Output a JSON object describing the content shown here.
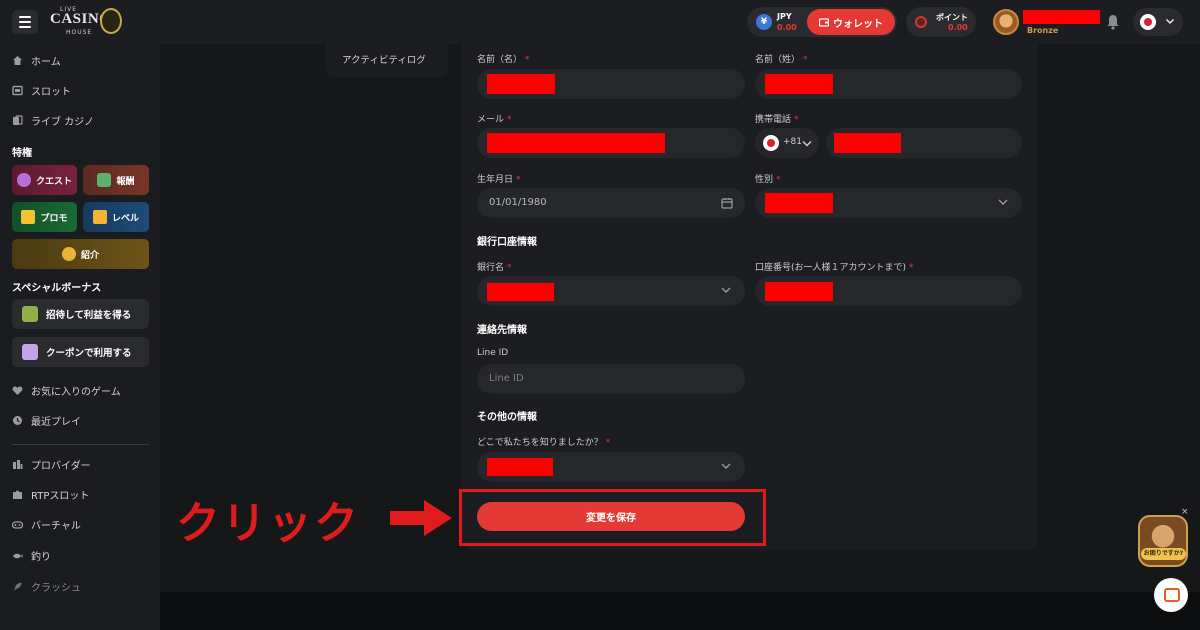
{
  "header": {
    "logo": {
      "top": "LIVE",
      "main": "CASINO",
      "bottom": "HOUSE"
    },
    "currency_code": "JPY",
    "currency_amount": "0.00",
    "wallet_label": "ウォレット",
    "points_label": "ポイント",
    "points_amount": "0.00",
    "rank": "Bronze"
  },
  "sidebar": {
    "nav_top": [
      {
        "label": "ホーム",
        "icon": "home-icon"
      },
      {
        "label": "スロット",
        "icon": "slot-icon"
      },
      {
        "label": "ライブ カジノ",
        "icon": "cards-icon"
      }
    ],
    "perks_title": "特権",
    "perks": [
      {
        "label": "クエスト",
        "icon": "quest-icon"
      },
      {
        "label": "報酬",
        "icon": "reward-icon"
      },
      {
        "label": "プロモ",
        "icon": "promo-icon"
      },
      {
        "label": "レベル",
        "icon": "crown-icon"
      },
      {
        "label": "紹介",
        "icon": "referral-icon"
      }
    ],
    "special_title": "スペシャルボーナス",
    "bonus_buttons": [
      {
        "label": "招待して利益を得る",
        "icon": "invite-icon"
      },
      {
        "label": "クーポンで利用する",
        "icon": "coupon-icon"
      }
    ],
    "nav_mid": [
      {
        "label": "お気に入りのゲーム",
        "icon": "heart-icon"
      },
      {
        "label": "最近プレイ",
        "icon": "clock-icon"
      }
    ],
    "nav_bottom": [
      {
        "label": "プロバイダー",
        "icon": "provider-icon"
      },
      {
        "label": "RTPスロット",
        "icon": "puzzle-icon"
      },
      {
        "label": "バーチャル",
        "icon": "gamepad-icon"
      },
      {
        "label": "釣り",
        "icon": "fishing-icon"
      },
      {
        "label": "クラッシュ",
        "icon": "rocket-icon"
      }
    ]
  },
  "tab_menu": {
    "item": "アクティビティログ"
  },
  "form": {
    "first_name_label": "名前（名）",
    "last_name_label": "名前（姓）",
    "email_label": "メール",
    "phone_label": "携帯電話",
    "country_code": "+81",
    "birthdate_label": "生年月日",
    "birthdate_value": "01/01/1980",
    "gender_label": "性別",
    "bank_section": "銀行口座情報",
    "bank_name_label": "銀行名",
    "account_number_label": "口座番号(お一人様１アカウントまで)",
    "contact_section": "連絡先情報",
    "line_id_label": "Line ID",
    "line_id_placeholder": "Line ID",
    "other_section": "その他の情報",
    "referral_source_label": "どこで私たちを知りましたか？",
    "required_mark": "*",
    "save_label": "変更を保存"
  },
  "annotation": {
    "click_text": "クリック"
  },
  "support": {
    "tag": "お困りですか?",
    "close": "×"
  },
  "colors": {
    "accent": "#e53935",
    "redaction": "#ff0000",
    "annotation": "#e01b1b"
  }
}
